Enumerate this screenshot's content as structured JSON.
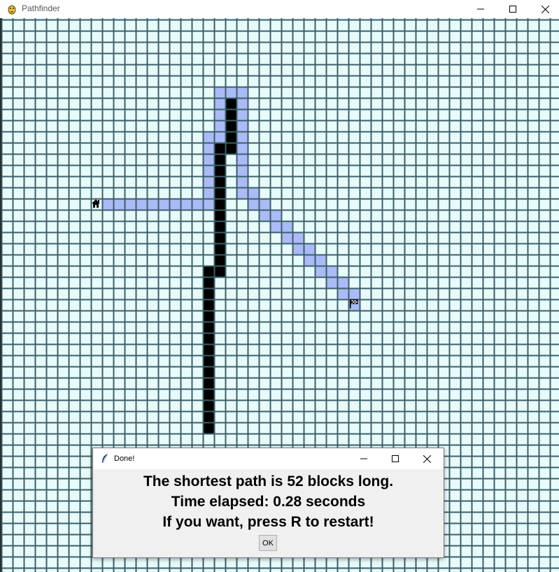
{
  "window": {
    "title": "Pathfinder",
    "minimize_glyph": "—",
    "maximize_glyph": "☐",
    "close_glyph": "✕"
  },
  "grid": {
    "background_color": "#e8fbfb",
    "line_color": "#3d5f69",
    "visited_color": "#aabbf7",
    "wall_color": "#000000",
    "start_icon": "house-icon",
    "end_icon": "checkered-flag-icon"
  },
  "dialog": {
    "title": "Done!",
    "icon": "feather-icon",
    "line1": "The shortest path is 52 blocks long.",
    "line2": "Time elapsed: 0.28 seconds",
    "line3": "If you want, press R to restart!",
    "ok_label": "OK"
  }
}
